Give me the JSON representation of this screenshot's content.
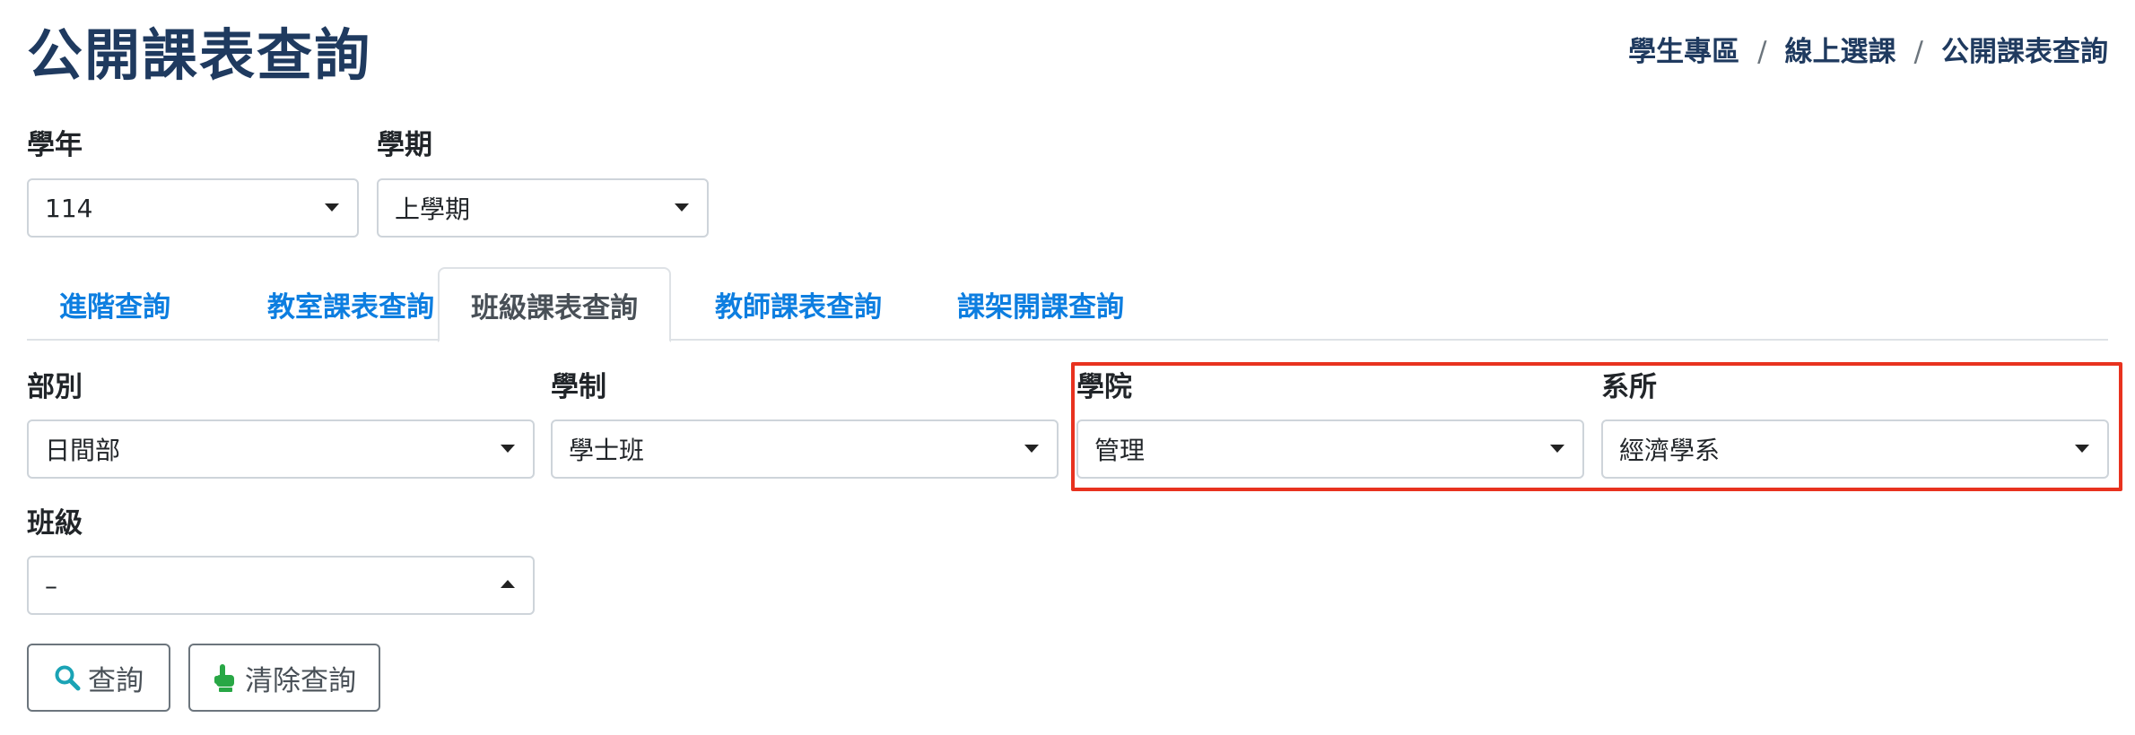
{
  "page": {
    "title": "公開課表查詢",
    "breadcrumb": [
      "學生專區",
      "線上選課",
      "公開課表查詢"
    ],
    "breadcrumb_sep": "/"
  },
  "filters_top": {
    "year": {
      "label": "學年",
      "value": "114"
    },
    "term": {
      "label": "學期",
      "value": "上學期"
    }
  },
  "tabs": [
    {
      "label": "進階查詢",
      "active": false
    },
    {
      "label": "教室課表查詢",
      "active": false
    },
    {
      "label": "班級課表查詢",
      "active": true
    },
    {
      "label": "教師課表查詢",
      "active": false
    },
    {
      "label": "課架開課查詢",
      "active": false
    }
  ],
  "class_query": {
    "division": {
      "label": "部別",
      "value": "日間部"
    },
    "system": {
      "label": "學制",
      "value": "學士班"
    },
    "college": {
      "label": "學院",
      "value": "管理"
    },
    "department": {
      "label": "系所",
      "value": "經濟學系"
    },
    "class": {
      "label": "班級",
      "value": "–"
    }
  },
  "buttons": {
    "search": {
      "label": "查詢",
      "icon": "search-icon"
    },
    "clear": {
      "label": "清除查詢",
      "icon": "pointing-hand-icon"
    }
  },
  "colors": {
    "title": "#1f3a5f",
    "tab_link": "#0d7ee0",
    "highlight_box": "#e8321f",
    "search_icon": "#1aa3b5",
    "clear_icon": "#28a745"
  }
}
